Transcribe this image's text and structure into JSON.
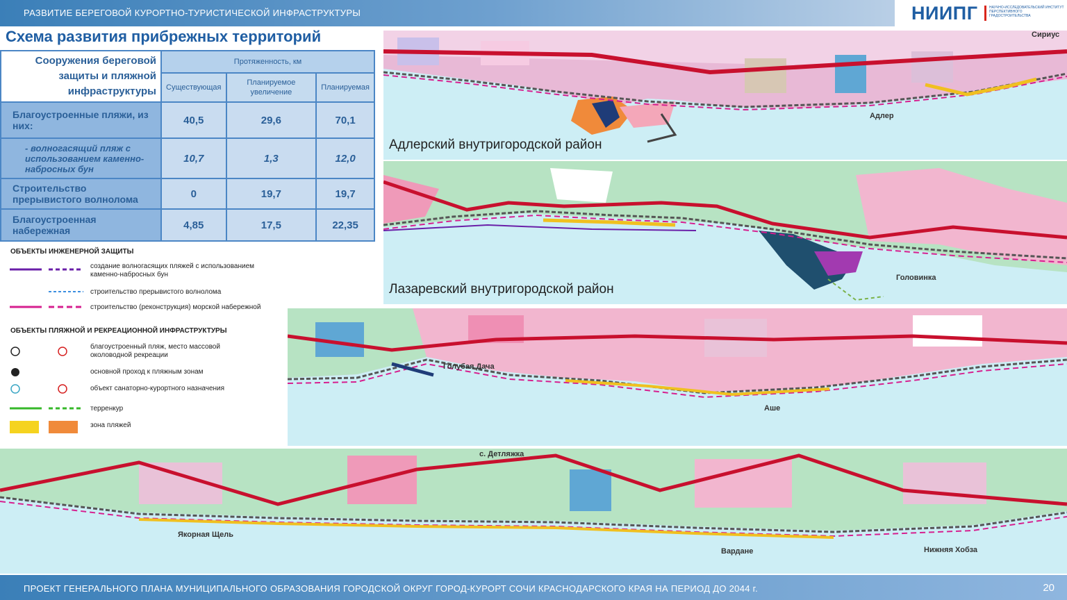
{
  "header": {
    "title": "РАЗВИТИЕ БЕРЕГОВОЙ КУРОРТНО-ТУРИСТИЧЕСКОЙ ИНФРАСТРУКТУРЫ"
  },
  "logo": {
    "name": "НИИПГ",
    "subtitle": "НАУЧНО-ИССЛЕДОВАТЕЛЬСКИЙ ИНСТИТУТ ПЕРСПЕКТИВНОГО ГРАДОСТРОИТЕЛЬСТВА"
  },
  "page_title": "Схема развития прибрежных территорий",
  "table": {
    "header_main": "Сооружения береговой защиты и пляжной инфраструктуры",
    "header_group": "Протяженность, км",
    "columns": [
      "Существующая",
      "Планируемое увеличение",
      "Планируемая"
    ],
    "rows": [
      {
        "label": "Благоустроенные пляжи, из них:",
        "values": [
          "40,5",
          "29,6",
          "70,1"
        ]
      },
      {
        "label": "- волногасящий пляж с использованием каменно-набросных бун",
        "values": [
          "10,7",
          "1,3",
          "12,0"
        ]
      },
      {
        "label": "Строительство прерывистого волнолома",
        "values": [
          "0",
          "19,7",
          "19,7"
        ]
      },
      {
        "label": "Благоустроенная набережная",
        "values": [
          "4,85",
          "17,5",
          "22,35"
        ]
      }
    ]
  },
  "legend": {
    "eng_title": "ОБЪЕКТЫ ИНЖЕНЕРНОЙ ЗАЩИТЫ",
    "eng_items": [
      "создание волногасящих пляжей с использованием каменно-набросных бун",
      "строительство прерывистого волнолома",
      "строительство (реконструкция) морской набережной"
    ],
    "beach_title": "ОБЪЕКТЫ ПЛЯЖНОЙ И РЕКРЕАЦИОННОЙ ИНФРАСТРУКТУРЫ",
    "beach_items": [
      "благоустроенный пляж, место массовой околоводной рекреации",
      "основной проход к пляжным зонам",
      "объект санаторно-курортного назначения",
      "терренкур",
      "зона пляжей"
    ]
  },
  "maps": {
    "adler": {
      "district": "Адлерский внутригородской район",
      "places": [
        "Адлер",
        "Сириус"
      ]
    },
    "lazarev": {
      "district": "Лазаревский внутригородской район",
      "places": [
        "Головинка"
      ]
    },
    "middle": {
      "places": [
        "Голубая Дача",
        "Аше"
      ]
    },
    "bottom": {
      "places": [
        "Якорная Щель",
        "с. Детляжка",
        "Вардане",
        "Нижняя Хобза"
      ]
    }
  },
  "colors": {
    "sea": "#cdeef5",
    "land": "#b7e3c3",
    "road": "#c8102e",
    "accent": "#1f5ea3"
  },
  "footer": {
    "text": "ПРОЕКТ ГЕНЕРАЛЬНОГО ПЛАНА МУНИЦИПАЛЬНОГО ОБРАЗОВАНИЯ ГОРОДСКОЙ ОКРУГ ГОРОД-КУРОРТ СОЧИ КРАСНОДАРСКОГО КРАЯ НА ПЕРИОД ДО 2044 г.",
    "page": "20"
  }
}
